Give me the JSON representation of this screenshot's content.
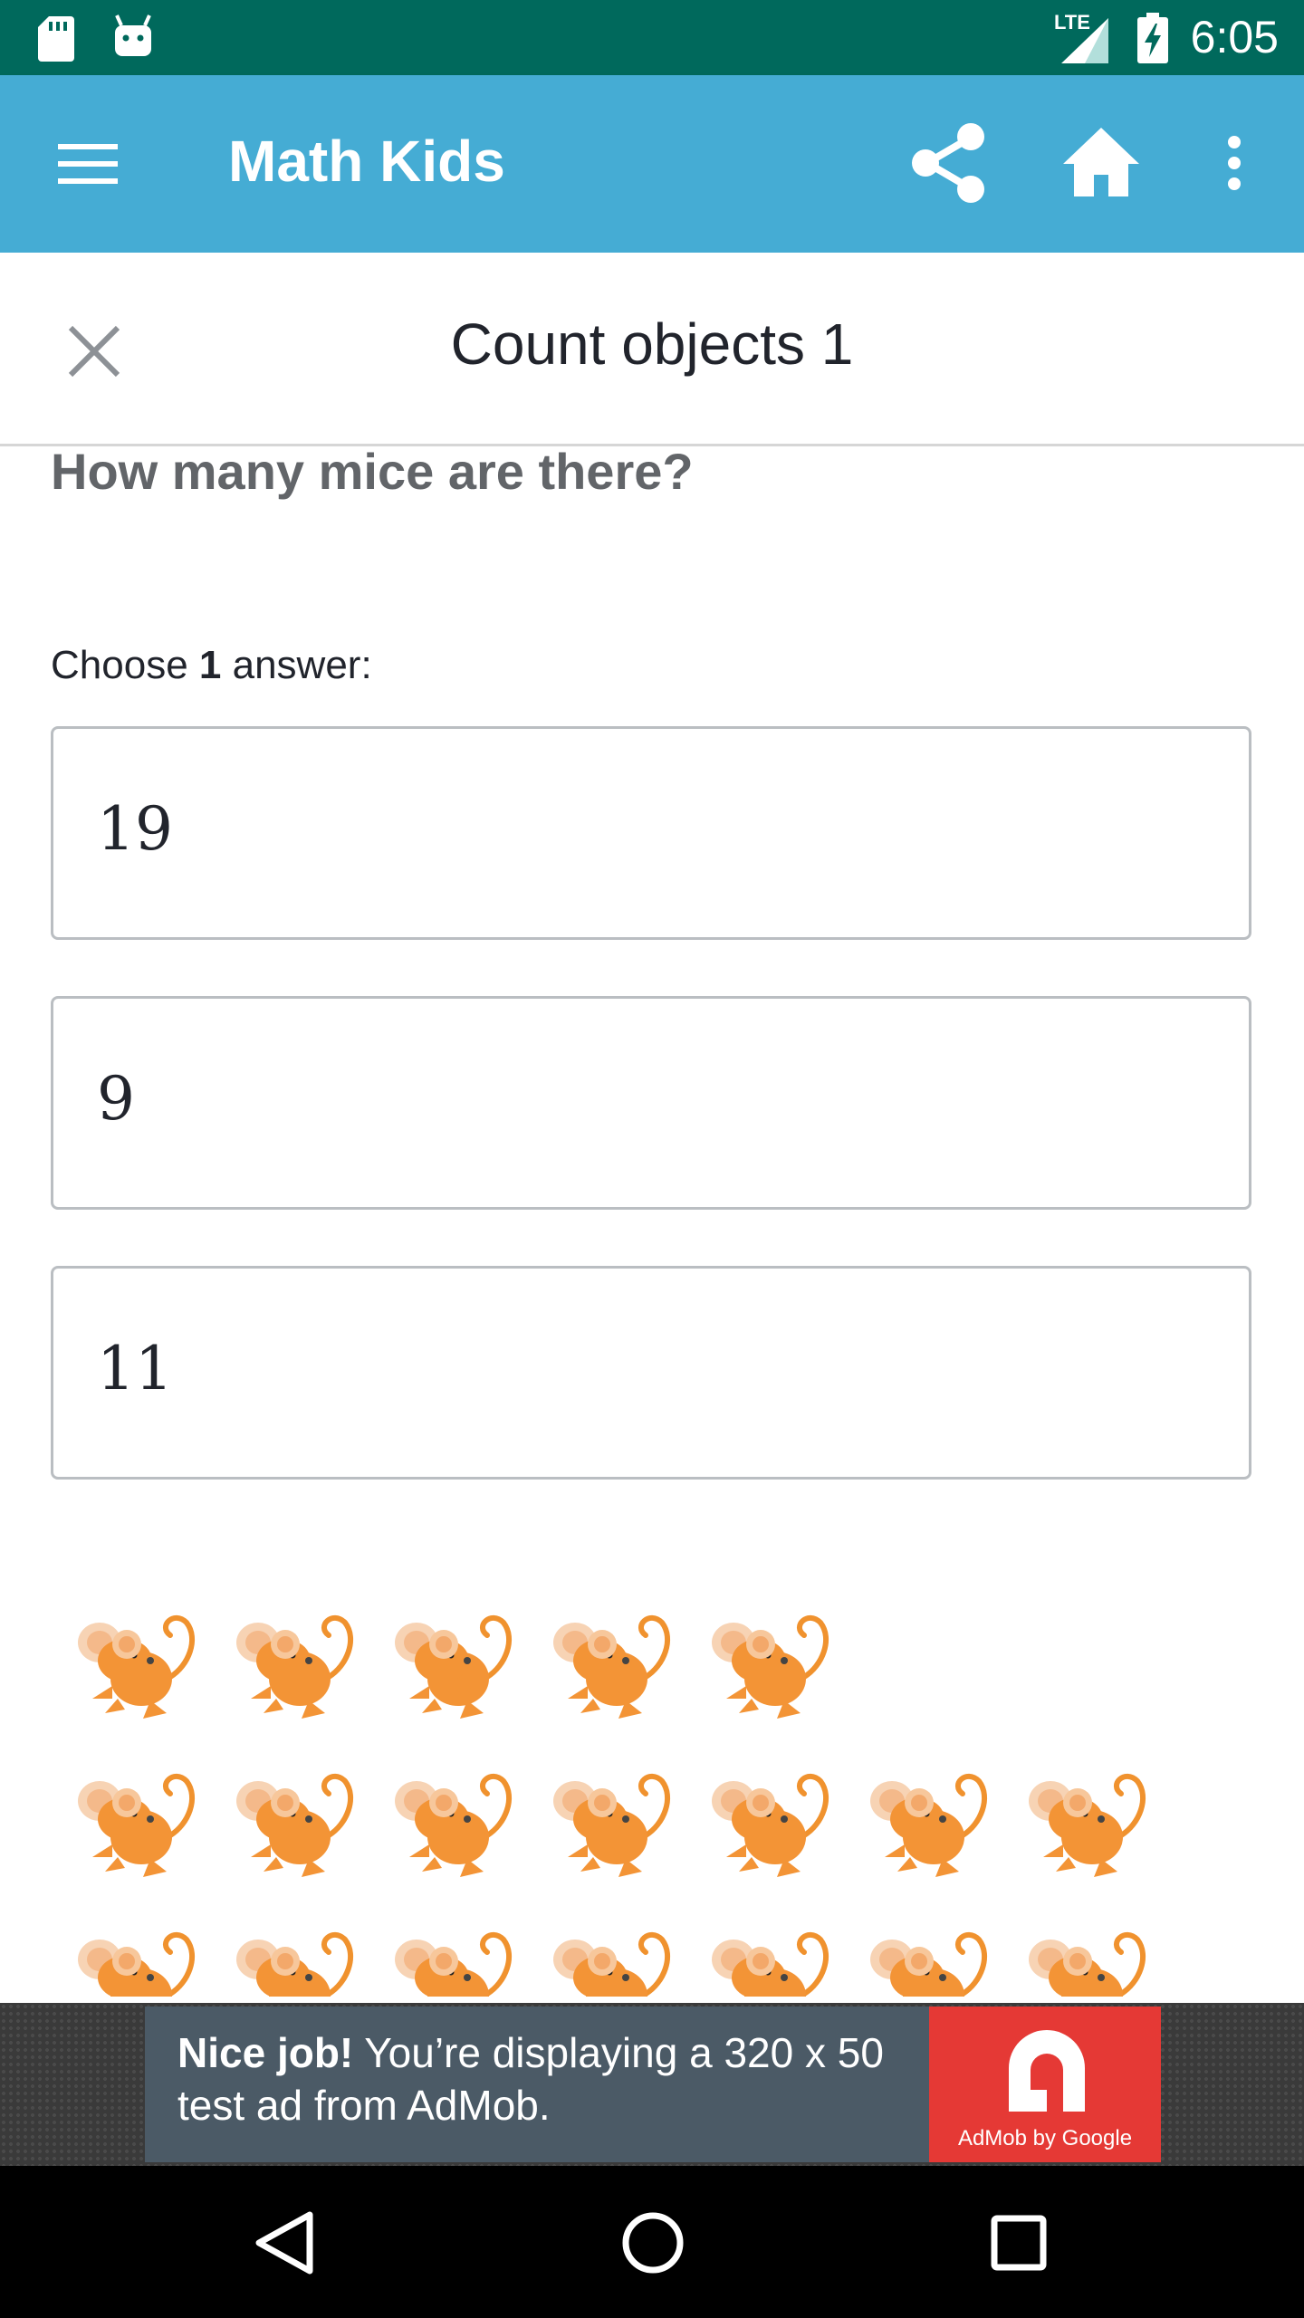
{
  "status_bar": {
    "time": "6:05",
    "network": "LTE",
    "icons": [
      "sd-card-icon",
      "android-icon",
      "signal-icon",
      "battery-charging-icon"
    ]
  },
  "app_bar": {
    "title": "Math Kids",
    "icons": [
      "menu-icon",
      "share-icon",
      "home-icon",
      "more-vert-icon"
    ],
    "color": "#45acd4"
  },
  "exercise": {
    "title": "Count objects 1",
    "question": "How many mice are there?",
    "choose_prefix": "Choose ",
    "choose_count": "1",
    "choose_suffix": " answer:",
    "answers": [
      "19",
      "9",
      "11"
    ],
    "mice_rows": [
      5,
      7,
      7
    ]
  },
  "ad": {
    "bold": "Nice job!",
    "text": " You’re displaying a 320 x 50 test ad from AdMob.",
    "logo_text": "AdMob by Google",
    "logo_color": "#e53935"
  },
  "nav_bar": {
    "icons": [
      "back-icon",
      "home-circle-icon",
      "recents-icon"
    ]
  }
}
